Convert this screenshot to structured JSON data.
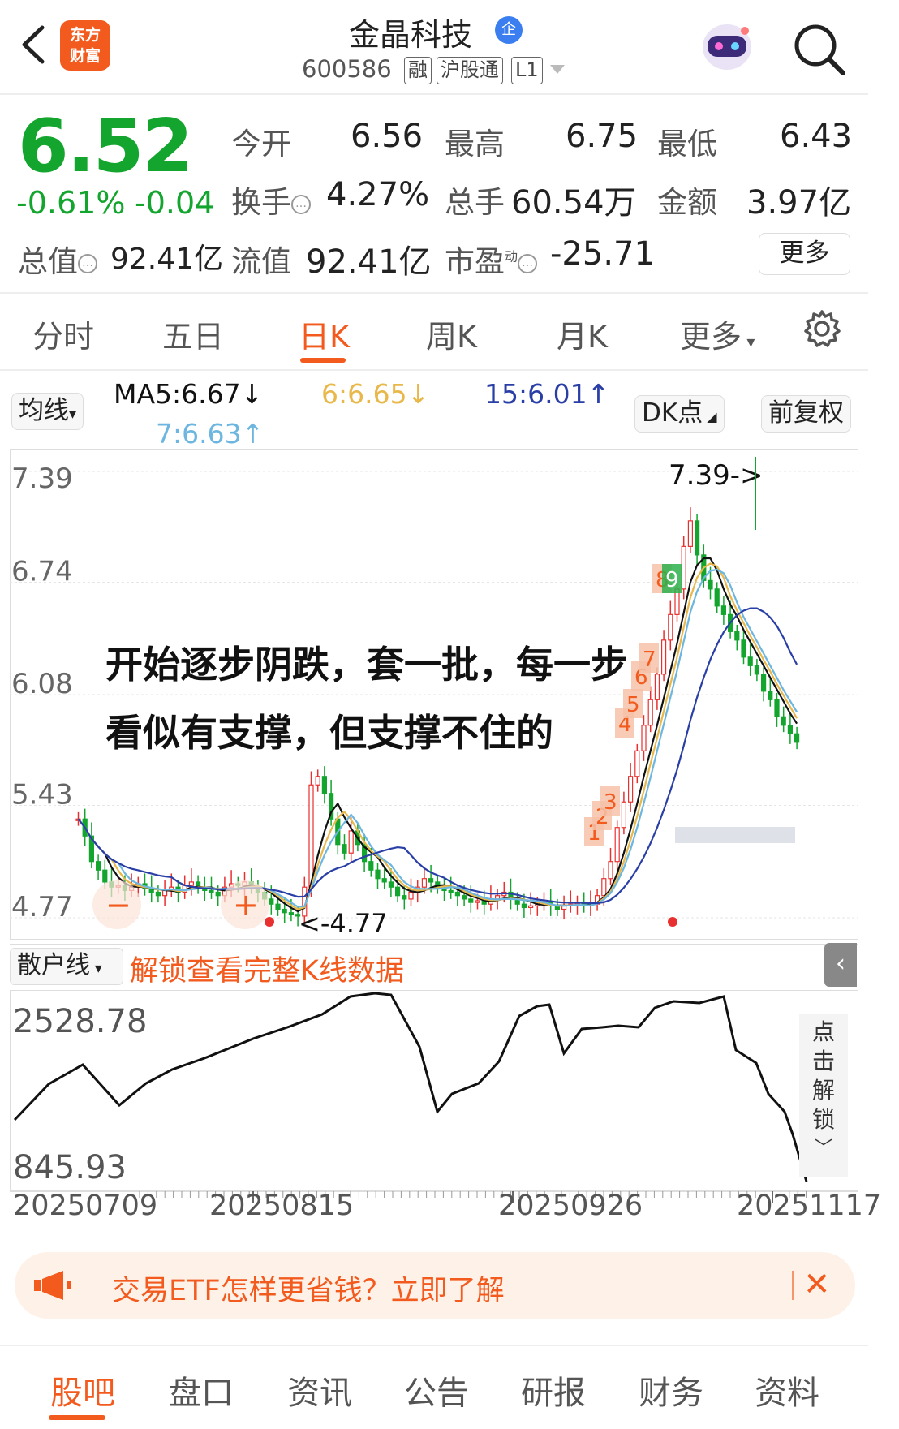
{
  "header": {
    "logo_line1": "东方",
    "logo_line2": "财富",
    "stock_name": "金晶科技",
    "ent_badge": "企",
    "stock_code": "600586",
    "tags": [
      "融",
      "沪股通",
      "L1"
    ]
  },
  "quote": {
    "price": "6.52",
    "change_pct": "-0.61%",
    "change_abs": "-0.04",
    "open_label": "今开",
    "open": "6.56",
    "high_label": "最高",
    "high": "6.75",
    "low_label": "最低",
    "low": "6.43",
    "turnover_label": "换手",
    "turnover": "4.27%",
    "volume_label": "总手",
    "volume": "60.54万",
    "amount_label": "金额",
    "amount": "3.97亿",
    "mktcap_label": "总值",
    "mktcap": "92.41亿",
    "float_label": "流值",
    "float": "92.41亿",
    "pe_label": "市盈",
    "pe_sup": "动",
    "pe": "-25.71",
    "more": "更多"
  },
  "tabs": [
    "分时",
    "五日",
    "日K",
    "周K",
    "月K",
    "更多"
  ],
  "active_tab": 2,
  "indicators": {
    "ma_select": "均线",
    "ma5": "MA5:6.67↓",
    "ma6": "6:6.65↓",
    "ma15": "15:6.01↑",
    "ma7": "7:6.63↑",
    "dk": "DK点",
    "adjust": "前复权"
  },
  "colors": {
    "accent": "#f25a1e",
    "up": "#e93030",
    "down": "#13a52e",
    "ma5": "#111111",
    "ma6": "#e8b84a",
    "ma15": "#2a3fa6",
    "ma7": "#6cb6e0"
  },
  "kchart": {
    "y_labels": [
      "7.39",
      "6.74",
      "6.08",
      "5.43",
      "4.77"
    ],
    "high_marker": "7.39->",
    "low_marker": "<-4.77",
    "annotation_line1": "开始逐步阴跌，套一批，每一步",
    "annotation_line2": "看似有支撑，但支撑不住的",
    "minus_btn": "−",
    "plus_btn": "+"
  },
  "chart_data": {
    "type": "candlestick",
    "ylim": [
      4.77,
      7.39
    ],
    "y_ticks": [
      7.39,
      6.74,
      6.08,
      5.43,
      4.77
    ],
    "x_ticks": [
      "20250709",
      "20250815",
      "20250926",
      "20251117"
    ],
    "high": 7.39,
    "low": 4.77
  },
  "subchart": {
    "selector": "散户线",
    "unlock_link": "解锁查看完整K线数据",
    "y_labels": [
      "2528.78",
      "845.93"
    ],
    "unlock_side": [
      "点",
      "击",
      "解",
      "锁"
    ],
    "dates": [
      "20250709",
      "20250815",
      "20250926",
      "20251117"
    ]
  },
  "banner": {
    "text": "交易ETF怎样更省钱？立即了解"
  },
  "bottom_tabs": [
    "股吧",
    "盘口",
    "资讯",
    "公告",
    "研报",
    "财务",
    "资料"
  ]
}
